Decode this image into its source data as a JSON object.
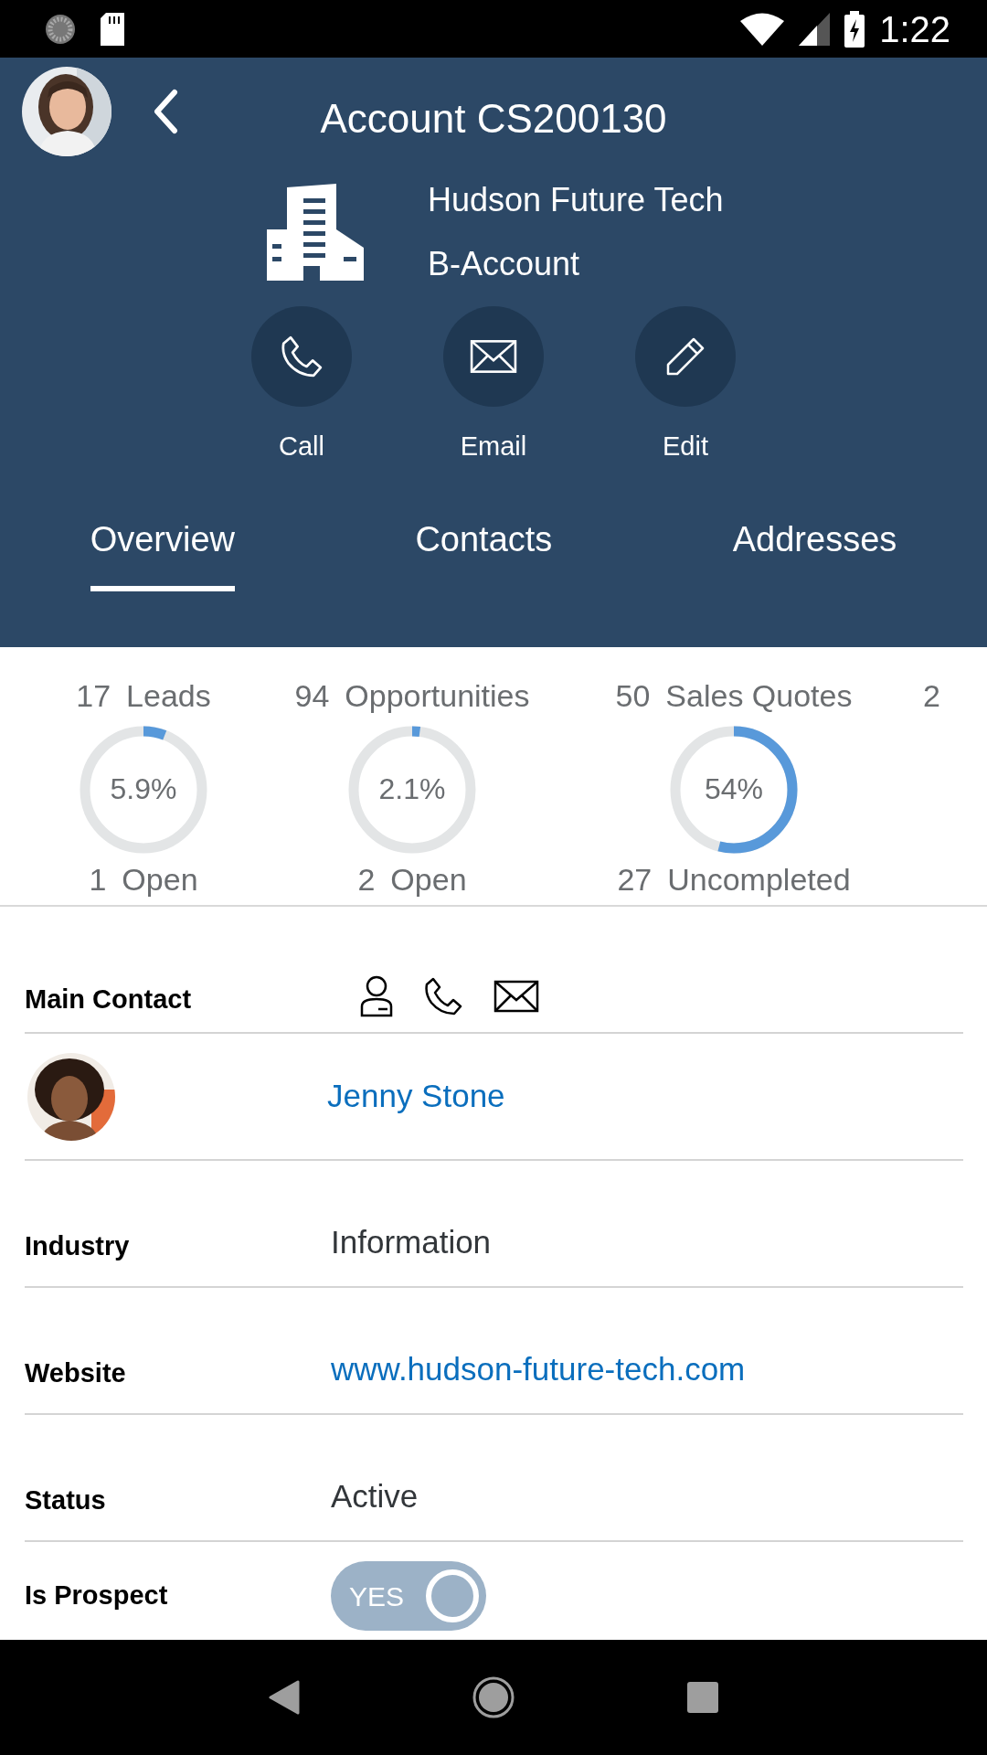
{
  "status_bar": {
    "time": "1:22"
  },
  "header": {
    "title": "Account CS200130",
    "company_name": "Hudson Future Tech",
    "account_type": "B-Account"
  },
  "actions": [
    {
      "kind": "call",
      "label": "Call"
    },
    {
      "kind": "email",
      "label": "Email"
    },
    {
      "kind": "edit",
      "label": "Edit"
    }
  ],
  "tabs": [
    {
      "label": "Overview",
      "selected": true
    },
    {
      "label": "Contacts",
      "selected": false
    },
    {
      "label": "Addresses",
      "selected": false
    }
  ],
  "kpis": [
    {
      "count": "17",
      "label": "Leads",
      "percent": "5.9%",
      "level": 0.059,
      "sub_count": "1",
      "sub_label": "Open"
    },
    {
      "count": "94",
      "label": "Opportunities",
      "percent": "2.1%",
      "level": 0.021,
      "sub_count": "2",
      "sub_label": "Open"
    },
    {
      "count": "50",
      "label": "Sales Quotes",
      "percent": "54%",
      "level": 0.54,
      "sub_count": "27",
      "sub_label": "Uncompleted"
    },
    {
      "count": "2"
    }
  ],
  "main_contact": {
    "label": "Main Contact",
    "name": "Jenny Stone"
  },
  "fields": [
    {
      "label": "Industry",
      "value": "Information",
      "kind": "text"
    },
    {
      "label": "Website",
      "value": "www.hudson-future-tech.com",
      "kind": "link"
    },
    {
      "label": "Status",
      "value": "Active",
      "kind": "text"
    }
  ],
  "is_prospect": {
    "label": "Is Prospect",
    "toggle_text": "YES",
    "on": true
  }
}
